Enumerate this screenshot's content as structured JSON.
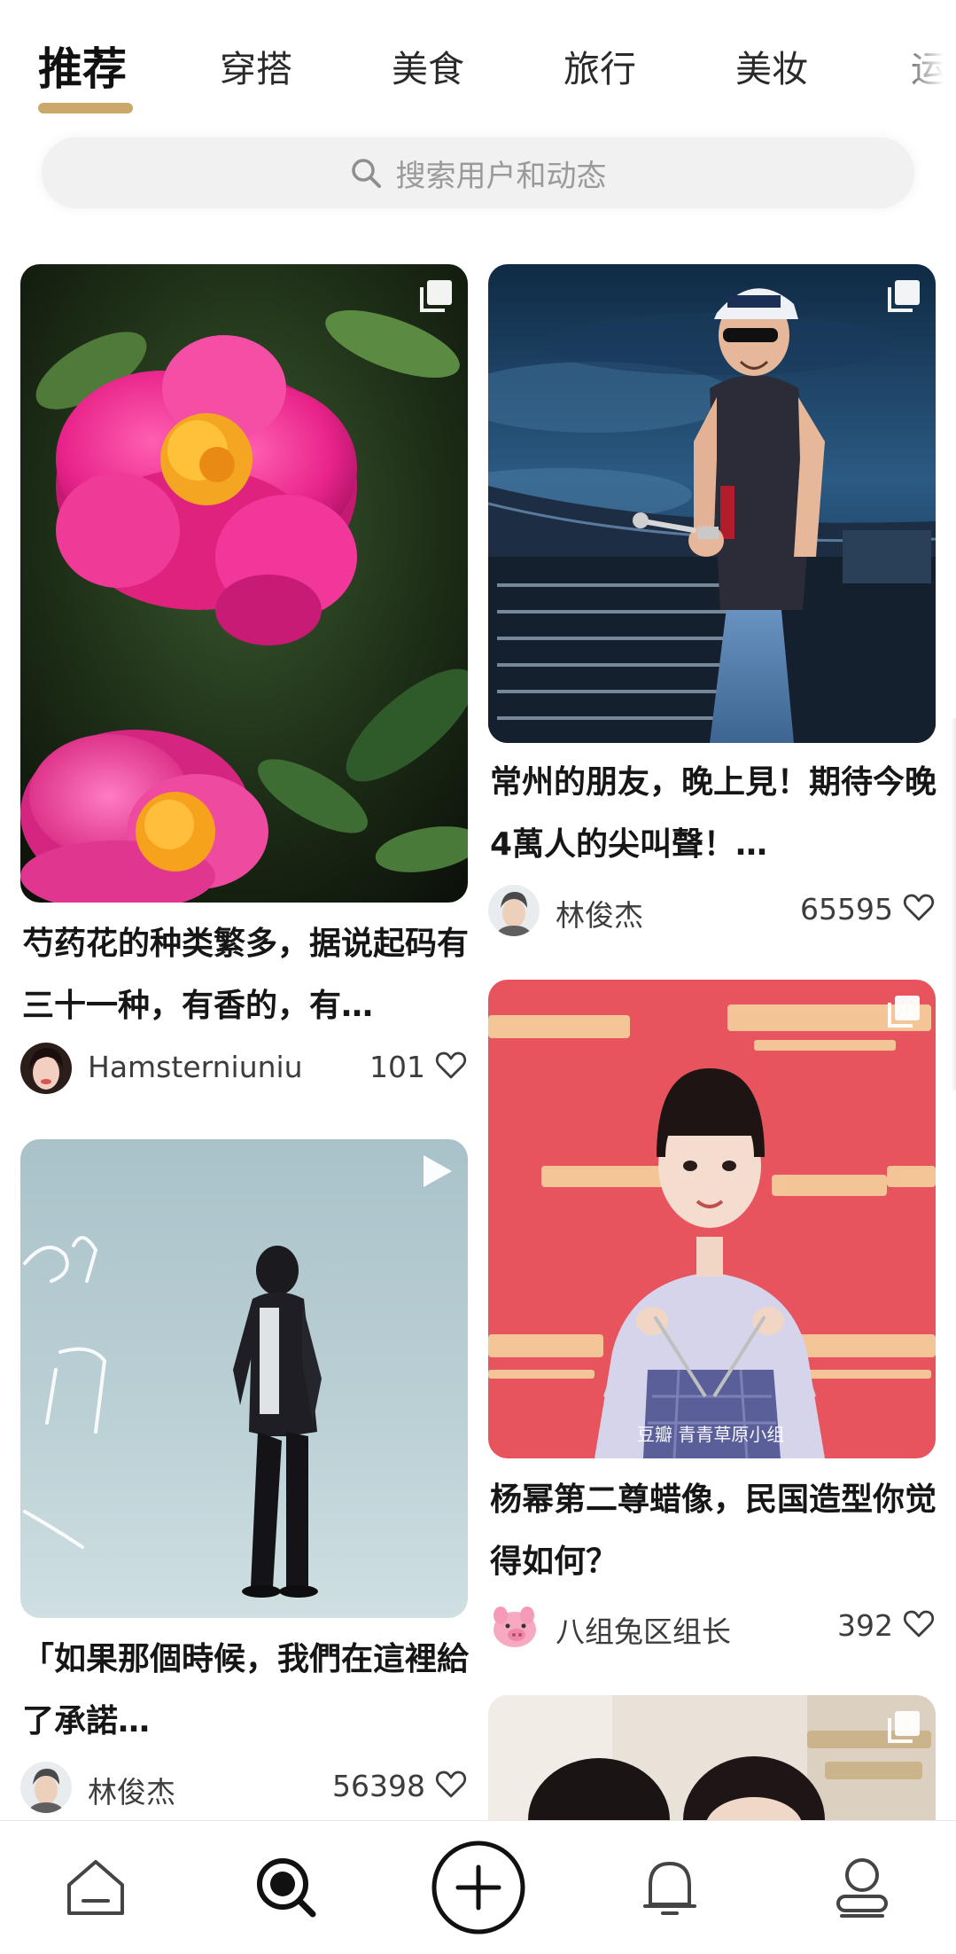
{
  "tabs": {
    "items": [
      "推荐",
      "穿搭",
      "美食",
      "旅行",
      "美妆",
      "运"
    ],
    "active_index": 0,
    "accent_color": "#c9a86a"
  },
  "search": {
    "placeholder": "搜索用户和动态",
    "icon": "search-icon"
  },
  "feed": {
    "left": [
      {
        "caption": "芍药花的种类繁多，据说起码有三十一种，有香的，有…",
        "author": "Hamsterniuniu",
        "likes": "101",
        "badge": "multi-image-icon"
      },
      {
        "caption": "「如果那個時候，我們在這裡給了承諾…",
        "author": "林俊杰",
        "likes": "56398",
        "badge": "play-icon"
      }
    ],
    "right": [
      {
        "caption": "常州的朋友，晚上見！期待今晚4萬人的尖叫聲！…",
        "author": "林俊杰",
        "likes": "65595",
        "badge": "multi-image-icon"
      },
      {
        "caption": "杨幂第二尊蜡像，民国造型你觉得如何？",
        "author": "八组兔区组长",
        "likes": "392",
        "badge": "multi-image-icon"
      },
      {
        "caption": "",
        "author": "",
        "likes": "",
        "badge": "multi-image-icon"
      }
    ]
  },
  "bottom_nav": {
    "items": [
      "home-icon",
      "discover-icon",
      "create-icon",
      "notifications-icon",
      "profile-icon"
    ],
    "active": "discover-icon"
  }
}
